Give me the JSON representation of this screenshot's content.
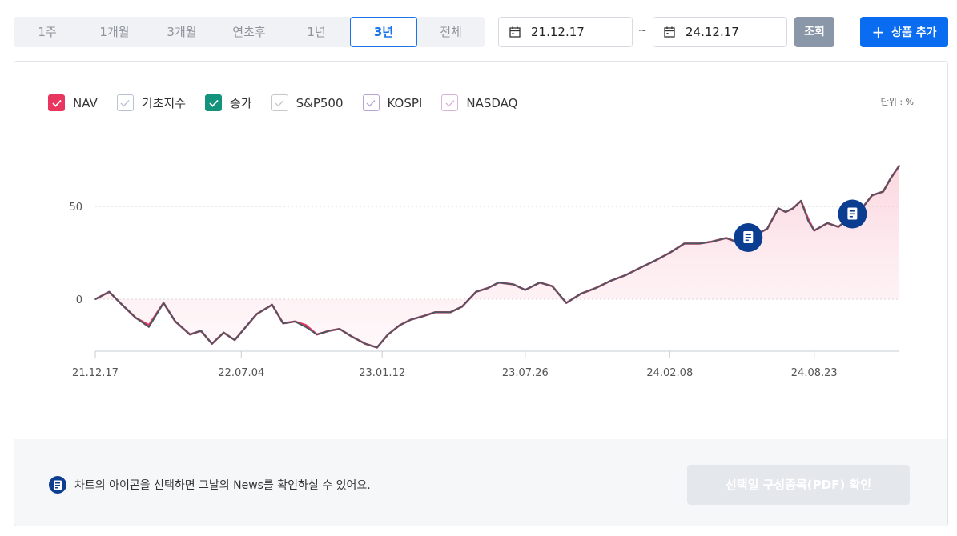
{
  "periods": [
    {
      "label": "1주",
      "active": false
    },
    {
      "label": "1개월",
      "active": false
    },
    {
      "label": "3개월",
      "active": false
    },
    {
      "label": "연초후",
      "active": false
    },
    {
      "label": "1년",
      "active": false
    },
    {
      "label": "3년",
      "active": true
    },
    {
      "label": "전체",
      "active": false
    }
  ],
  "date_range": {
    "start": "21.12.17",
    "separator": "~",
    "end": "24.12.17"
  },
  "buttons": {
    "query": "조회",
    "add_plus": "+",
    "add_product": "상품 추가",
    "pdf": "선택일 구성종목(PDF) 확인"
  },
  "legend": [
    {
      "label": "NAV",
      "checked": true,
      "color": "#e8365f"
    },
    {
      "label": "기초지수",
      "checked": false,
      "color": "#b7c3d3"
    },
    {
      "label": "종가",
      "checked": true,
      "color": "#14937c"
    },
    {
      "label": "S&P500",
      "checked": false,
      "color": "#c7c7c7"
    },
    {
      "label": "KOSPI",
      "checked": false,
      "color": "#b9a4d8"
    },
    {
      "label": "NASDAQ",
      "checked": false,
      "color": "#d9b3d9"
    }
  ],
  "unit_label": "단위 : %",
  "note": "차트의 아이콘을 선택하면 그날의 News를 확인하실 수 있어요.",
  "colors": {
    "accent": "#1a73e8",
    "nav": "#e8365f",
    "close": "#14937c",
    "line": "#4d5763",
    "news": "#0b3d91"
  },
  "chart_data": {
    "type": "line",
    "ylabel": "",
    "unit": "%",
    "yticks": [
      0,
      50
    ],
    "ylim": [
      -28,
      72
    ],
    "xlim": [
      "2021-12-17",
      "2024-12-17"
    ],
    "x_tick_labels": [
      "21.12.17",
      "22.07.04",
      "23.01.12",
      "23.07.26",
      "24.02.08",
      "24.08.23"
    ],
    "x_tick_dates": [
      "2021-12-17",
      "2022-07-04",
      "2023-01-12",
      "2023-07-26",
      "2024-02-08",
      "2024-08-23"
    ],
    "news_marker_dates": [
      "2024-05-25",
      "2024-10-14"
    ],
    "series": [
      {
        "name": "NAV",
        "dates": [
          "2021-12-17",
          "2022-01-05",
          "2022-01-20",
          "2022-02-10",
          "2022-02-28",
          "2022-03-20",
          "2022-04-05",
          "2022-04-25",
          "2022-05-10",
          "2022-05-25",
          "2022-06-10",
          "2022-06-25",
          "2022-07-10",
          "2022-07-25",
          "2022-08-15",
          "2022-08-30",
          "2022-09-15",
          "2022-09-30",
          "2022-10-15",
          "2022-11-01",
          "2022-11-15",
          "2022-12-01",
          "2022-12-20",
          "2023-01-05",
          "2023-01-20",
          "2023-02-05",
          "2023-02-20",
          "2023-03-10",
          "2023-03-25",
          "2023-04-15",
          "2023-05-01",
          "2023-05-20",
          "2023-06-05",
          "2023-06-20",
          "2023-07-10",
          "2023-07-26",
          "2023-08-15",
          "2023-09-01",
          "2023-09-20",
          "2023-10-10",
          "2023-10-30",
          "2023-11-20",
          "2023-12-10",
          "2023-12-30",
          "2024-01-20",
          "2024-02-08",
          "2024-02-28",
          "2024-03-20",
          "2024-04-05",
          "2024-04-25",
          "2024-05-15",
          "2024-06-01",
          "2024-06-20",
          "2024-07-05",
          "2024-07-15",
          "2024-07-25",
          "2024-08-05",
          "2024-08-15",
          "2024-08-23",
          "2024-09-10",
          "2024-09-25",
          "2024-10-10",
          "2024-10-25",
          "2024-11-10",
          "2024-11-25",
          "2024-12-05",
          "2024-12-17"
        ],
        "values": [
          0,
          4,
          -2,
          -10,
          -14,
          -2,
          -12,
          -19,
          -17,
          -24,
          -18,
          -22,
          -15,
          -8,
          -3,
          -13,
          -12,
          -14,
          -19,
          -17,
          -16,
          -20,
          -24,
          -26,
          -19,
          -14,
          -11,
          -9,
          -7,
          -7,
          -4,
          4,
          6,
          9,
          8,
          5,
          9,
          7,
          -2,
          3,
          6,
          10,
          13,
          17,
          21,
          25,
          30,
          30,
          31,
          33,
          30,
          34,
          38,
          49,
          47,
          49,
          53,
          43,
          37,
          41,
          39,
          44,
          48,
          56,
          58,
          65,
          72
        ]
      },
      {
        "name": "종가",
        "dates": [
          "2021-12-17",
          "2022-01-05",
          "2022-01-20",
          "2022-02-10",
          "2022-02-28",
          "2022-03-20",
          "2022-04-05",
          "2022-04-25",
          "2022-05-10",
          "2022-05-25",
          "2022-06-10",
          "2022-06-25",
          "2022-07-10",
          "2022-07-25",
          "2022-08-15",
          "2022-08-30",
          "2022-09-15",
          "2022-09-30",
          "2022-10-15",
          "2022-11-01",
          "2022-11-15",
          "2022-12-01",
          "2022-12-20",
          "2023-01-05",
          "2023-01-20",
          "2023-02-05",
          "2023-02-20",
          "2023-03-10",
          "2023-03-25",
          "2023-04-15",
          "2023-05-01",
          "2023-05-20",
          "2023-06-05",
          "2023-06-20",
          "2023-07-10",
          "2023-07-26",
          "2023-08-15",
          "2023-09-01",
          "2023-09-20",
          "2023-10-10",
          "2023-10-30",
          "2023-11-20",
          "2023-12-10",
          "2023-12-30",
          "2024-01-20",
          "2024-02-08",
          "2024-02-28",
          "2024-03-20",
          "2024-04-05",
          "2024-04-25",
          "2024-05-15",
          "2024-06-01",
          "2024-06-20",
          "2024-07-05",
          "2024-07-15",
          "2024-07-25",
          "2024-08-05",
          "2024-08-15",
          "2024-08-23",
          "2024-09-10",
          "2024-09-25",
          "2024-10-10",
          "2024-10-25",
          "2024-11-10",
          "2024-11-25",
          "2024-12-05",
          "2024-12-17"
        ],
        "values": [
          0,
          4,
          -2,
          -10,
          -15,
          -2,
          -12,
          -19,
          -17,
          -24,
          -18,
          -22,
          -15,
          -8,
          -3,
          -13,
          -12,
          -15,
          -19,
          -17,
          -16,
          -20,
          -24,
          -26,
          -19,
          -14,
          -11,
          -9,
          -7,
          -7,
          -4,
          4,
          6,
          9,
          8,
          5,
          9,
          7,
          -2,
          3,
          6,
          10,
          13,
          17,
          21,
          25,
          30,
          30,
          31,
          33,
          30,
          34,
          38,
          49,
          47,
          49,
          53,
          42,
          37,
          41,
          39,
          44,
          48,
          56,
          58,
          65,
          72
        ]
      }
    ]
  }
}
